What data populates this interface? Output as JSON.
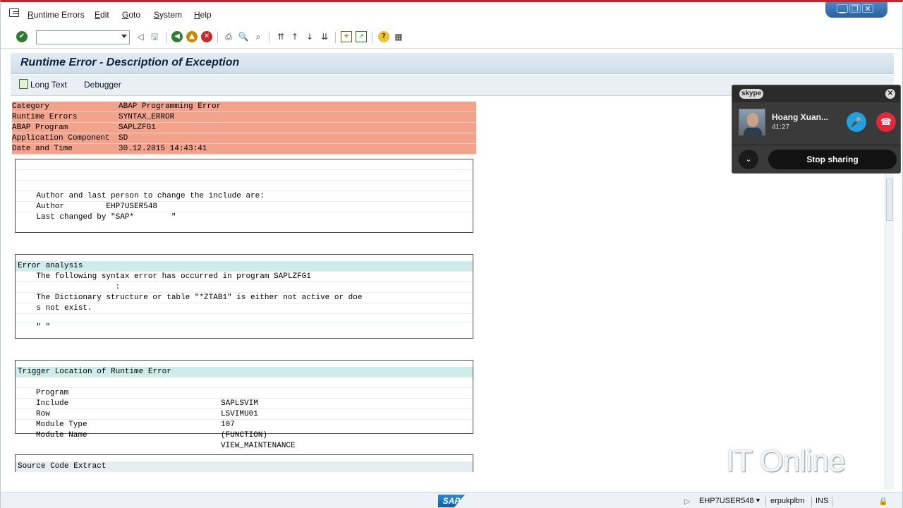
{
  "menu": [
    "Runtime Errors",
    "Edit",
    "Goto",
    "System",
    "Help"
  ],
  "window_controls": [
    "▁",
    "❐",
    "✕"
  ],
  "page_title": "Runtime Error - Description of Exception",
  "app_toolbar": {
    "long_text": "Long Text",
    "debugger": "Debugger"
  },
  "header": [
    {
      "label": "Category",
      "value": "ABAP Programming Error"
    },
    {
      "label": "Runtime Errors",
      "value": "SYNTAX_ERROR"
    },
    {
      "label": "ABAP Program",
      "value": "SAPLZFG1"
    },
    {
      "label": "Application Component",
      "value": "SD"
    },
    {
      "label": "Date and Time",
      "value": "30.12.2015 14:43:41"
    }
  ],
  "author_box": {
    "lines": [
      "",
      "",
      "",
      "    Author and last person to change the include are:",
      "    Author         EHP7USER548",
      "    Last changed by \"SAP*        \""
    ]
  },
  "error_analysis": {
    "title": "Error analysis",
    "lines": [
      "    The following syntax error has occurred in program SAPLZFG1",
      "                     :",
      "    The Dictionary structure or table \"*ZTAB1\" is either not active or doe",
      "    s not exist.",
      "",
      "    \" \""
    ]
  },
  "trigger_location": {
    "title": "Trigger Location of Runtime Error",
    "rows": [
      {
        "label": "Program",
        "value": "SAPLSVIM"
      },
      {
        "label": "Include",
        "value": "LSVIMU01"
      },
      {
        "label": "Row",
        "value": "107"
      },
      {
        "label": "Module Type",
        "value": "(FUNCTION)"
      },
      {
        "label": "Module Name",
        "value": "VIEW_MAINTENANCE"
      }
    ]
  },
  "source_code": {
    "title": "Source Code Extract"
  },
  "skype": {
    "logo": "skype",
    "caller_name": "Hoang Xuan...",
    "call_time": "41:27",
    "stop_sharing": "Stop sharing"
  },
  "watermark": "IT Online",
  "status": {
    "sap_logo": "SAP",
    "user": "EHP7USER548",
    "server": "erpukpltm",
    "mode": "INS"
  }
}
